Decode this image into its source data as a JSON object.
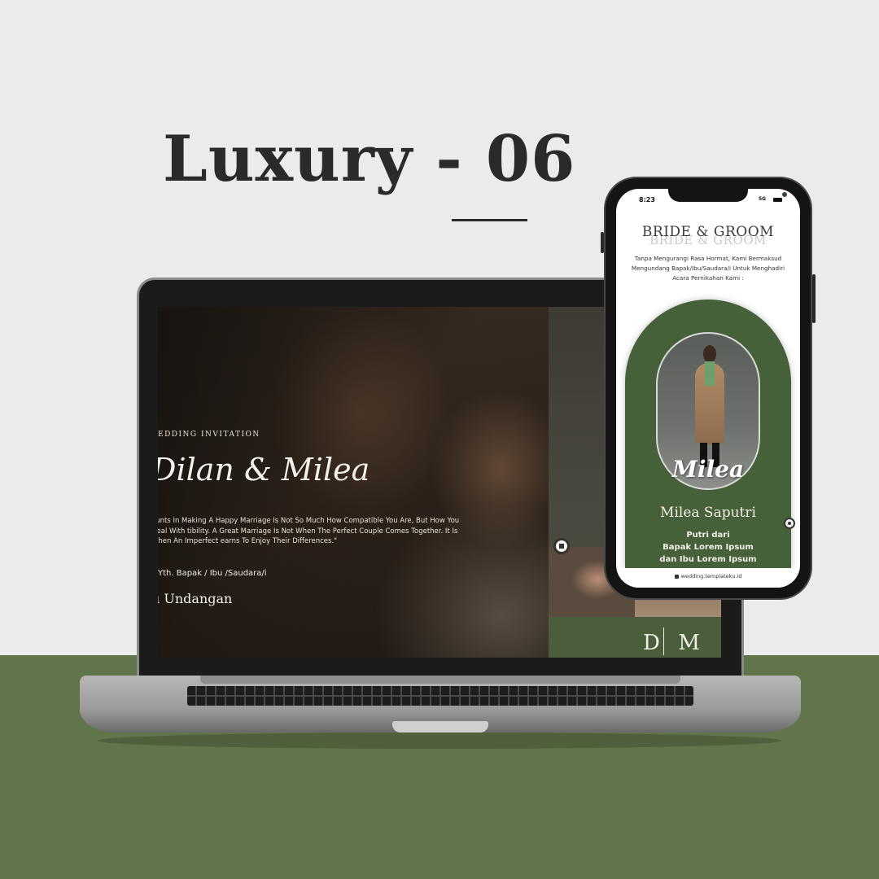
{
  "brand": {
    "title": "Luxury - 06",
    "colors": {
      "background": "#ebebeb",
      "accent_green": "#62754a",
      "arch_green": "#46613a"
    }
  },
  "laptop": {
    "eyebrow": "EDDING INVITATION",
    "couple_names": "Dilan & Milea",
    "quote": "ounts In Making A Happy Marriage Is Not So Much How Compatible You Are, But How You Deal With tibility. A Great Marriage Is Not When The Perfect Couple Comes Together. It Is When An Imperfect earns To Enjoy Their Differences.\"",
    "recipient": "Yth. Bapak / Ibu /Saudara/i",
    "open_button": "u Undangan",
    "monogram_left": "D",
    "monogram_right": "M",
    "music_icon": "stop-icon"
  },
  "phone": {
    "status_time": "8:23",
    "status_network": "5G",
    "section_title": "BRIDE & GROOM",
    "section_title_shadow": "BRIDE & GROOM",
    "intro": "Tanpa Mengurangi Rasa Hormat, Kami Bermaksud Mengundang Bapak/Ibu/Saudara/i Untuk Menghadiri Acara Pernikahan Kami :",
    "bride_script": "Milea",
    "bride_name": "Milea Saputri",
    "parents_line1": "Putri dari",
    "parents_line2": "Bapak Lorem Ipsum",
    "parents_line3": "dan Ibu Lorem Ipsum",
    "url": "wedding.templateku.id",
    "music_icon": "music-icon"
  }
}
